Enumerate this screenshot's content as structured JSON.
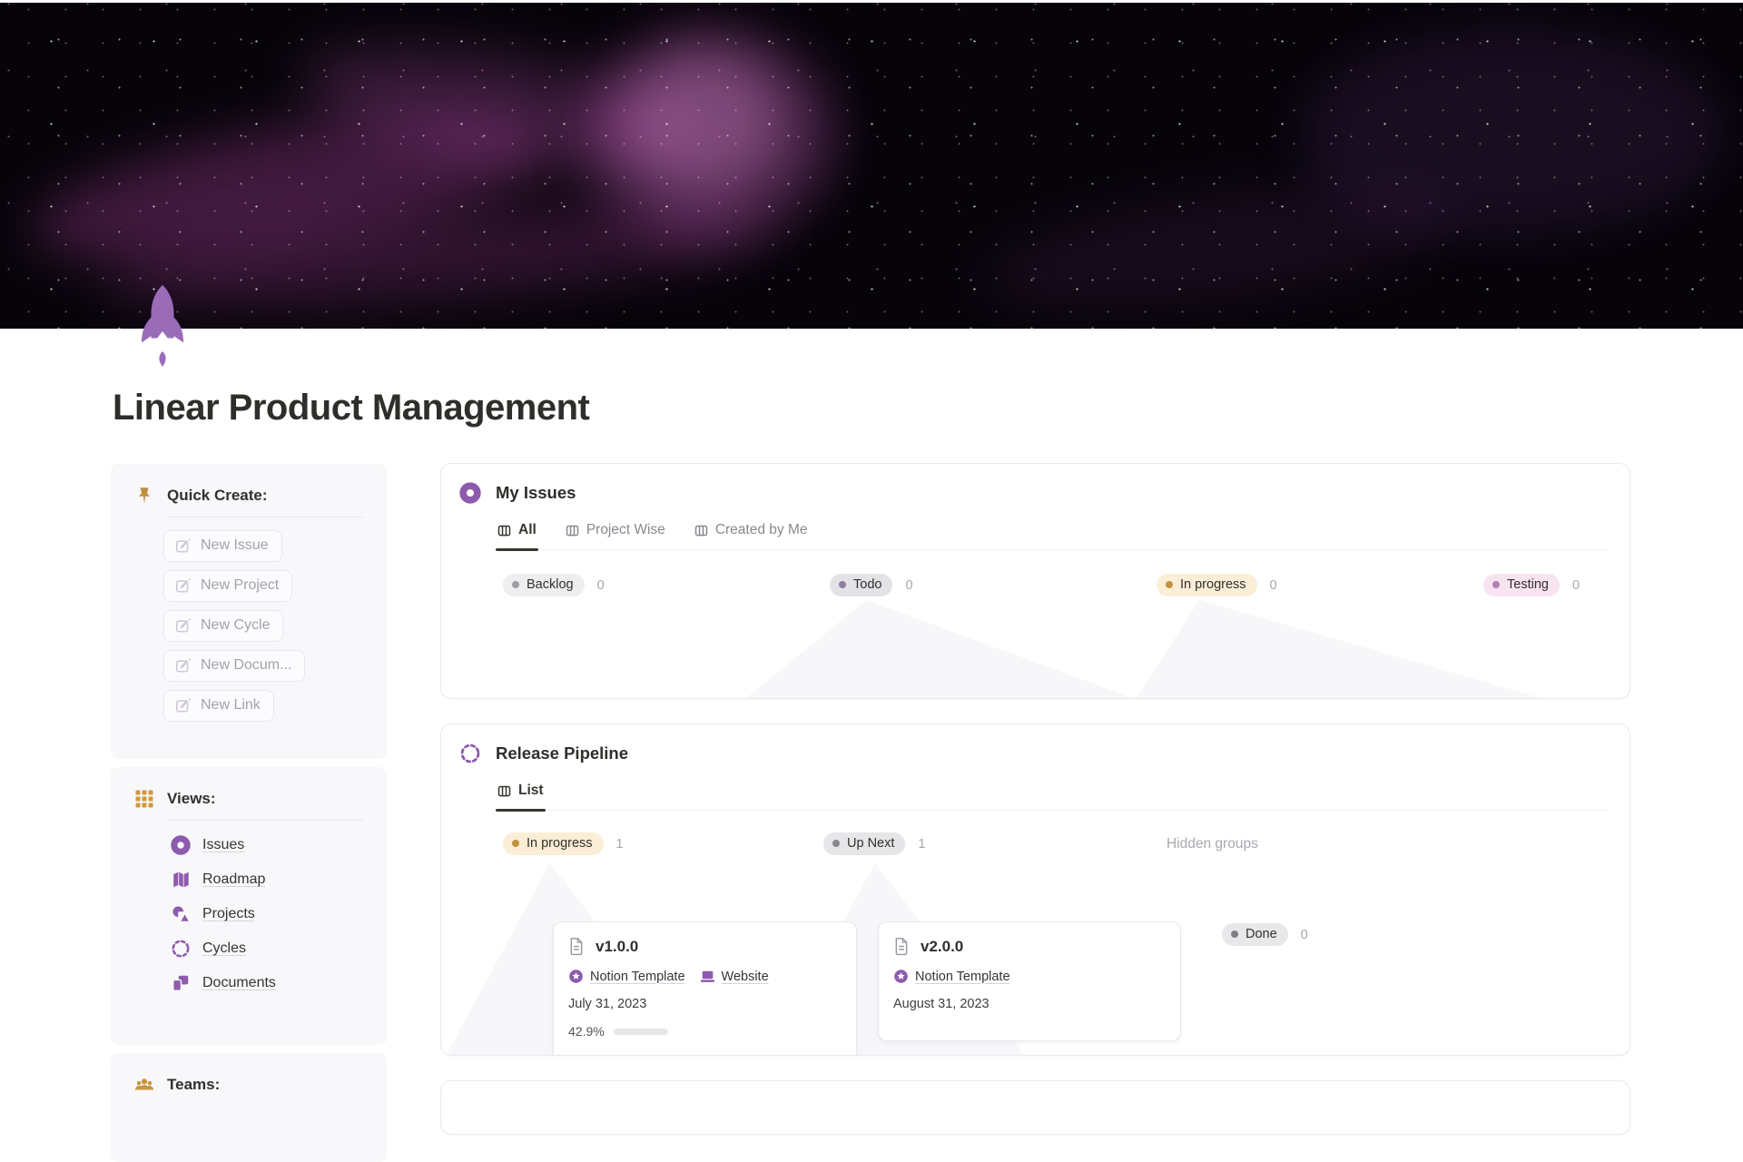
{
  "page": {
    "title": "Linear Product Management",
    "icon": "rocket-icon",
    "cover": "dark starfield with magenta nebula",
    "accent_purple": "#8d5bad",
    "accent_gold": "#c8963f",
    "nebula_color": "#c54cb4"
  },
  "sidebar": {
    "quick_create": {
      "title": "Quick Create:",
      "icon": "pushpin-icon",
      "buttons": [
        {
          "icon": "edit-icon",
          "label": "New Issue"
        },
        {
          "icon": "edit-icon",
          "label": "New Project"
        },
        {
          "icon": "edit-icon",
          "label": "New Cycle"
        },
        {
          "icon": "edit-icon",
          "label": "New Docum..."
        },
        {
          "icon": "edit-icon",
          "label": "New Link"
        }
      ]
    },
    "views": {
      "title": "Views:",
      "icon": "grid-icon",
      "items": [
        {
          "icon": "donut-icon",
          "label": "Issues"
        },
        {
          "icon": "map-icon",
          "label": "Roadmap"
        },
        {
          "icon": "shapes-icon",
          "label": "Projects"
        },
        {
          "icon": "dashed-circle-icon",
          "label": "Cycles"
        },
        {
          "icon": "pages-icon",
          "label": "Documents"
        }
      ]
    },
    "teams": {
      "title": "Teams:",
      "icon": "people-icon"
    }
  },
  "my_issues": {
    "icon": "donut-icon",
    "title": "My Issues",
    "tabs": [
      {
        "icon": "board-icon",
        "label": "All",
        "active": true
      },
      {
        "icon": "board-icon",
        "label": "Project Wise",
        "active": false
      },
      {
        "icon": "board-icon",
        "label": "Created by Me",
        "active": false
      }
    ],
    "groups": [
      {
        "label": "Backlog",
        "count": "0",
        "bg": "#edeef0",
        "dot": "#9d9ca3"
      },
      {
        "label": "Todo",
        "count": "0",
        "bg": "#e3e3e7",
        "dot": "#8d7f9d"
      },
      {
        "label": "In progress",
        "count": "0",
        "bg": "#fbeed7",
        "dot": "#c0913f"
      },
      {
        "label": "Testing",
        "count": "0",
        "bg": "#f8e3f0",
        "dot": "#b57fb5"
      }
    ]
  },
  "release_pipeline": {
    "icon": "dashed-circle-icon",
    "title": "Release Pipeline",
    "tabs": [
      {
        "icon": "board-icon",
        "label": "List",
        "active": true
      }
    ],
    "groups": [
      {
        "label": "In progress",
        "count": "1",
        "bg": "#fbeed7",
        "dot": "#c0913f"
      },
      {
        "label": "Up Next",
        "count": "1",
        "bg": "#e6e6e9",
        "dot": "#87868c"
      }
    ],
    "hidden_groups_label": "Hidden groups",
    "hidden_group": {
      "label": "Done",
      "count": "0",
      "bg": "#e8e8ea",
      "dot": "#7f7e84"
    },
    "cards": [
      {
        "icon": "document-icon",
        "title": "v1.0.0",
        "links": [
          {
            "icon": "badge-icon",
            "label": "Notion Template"
          },
          {
            "icon": "laptop-icon",
            "label": "Website"
          }
        ],
        "date": "July 31, 2023",
        "progress_label": "42.9%",
        "progress_pct": 42.9,
        "progress_fill": "#6e6d6a",
        "progress_track": "#e7e6e9"
      },
      {
        "icon": "document-icon",
        "title": "v2.0.0",
        "links": [
          {
            "icon": "badge-icon",
            "label": "Notion Template"
          }
        ],
        "date": "August 31, 2023"
      }
    ]
  }
}
